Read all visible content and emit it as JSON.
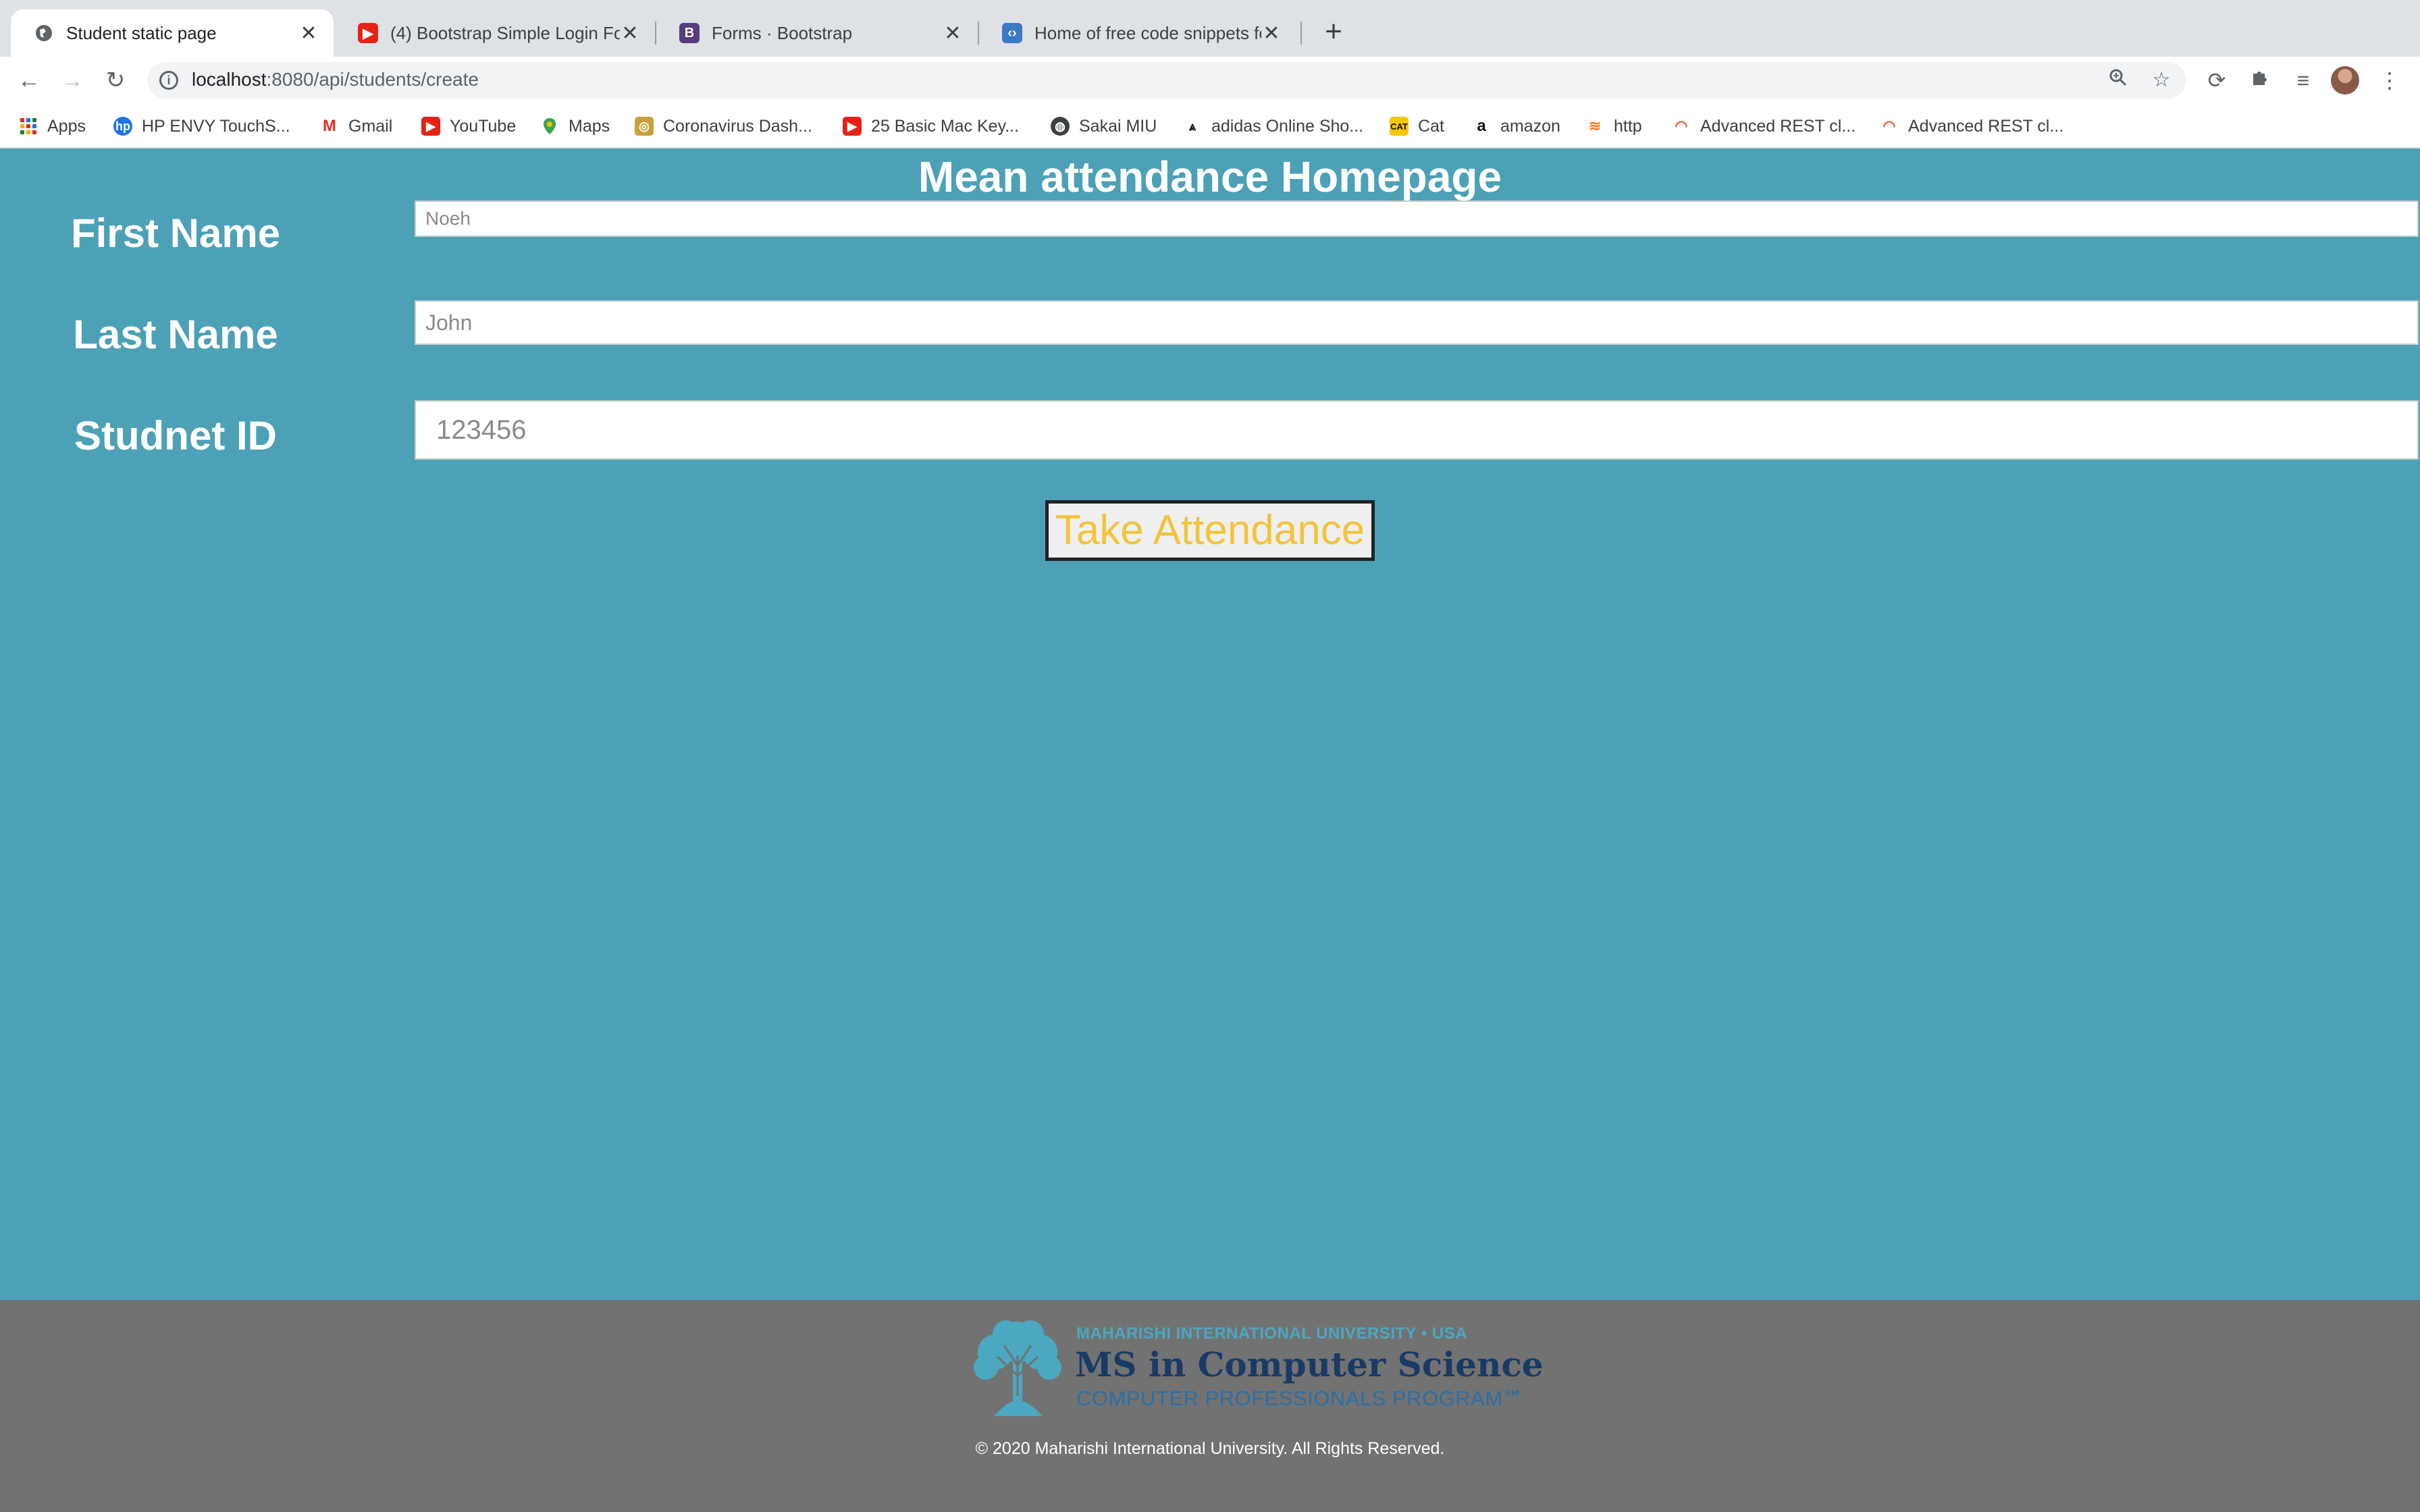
{
  "browser": {
    "tabs": [
      {
        "title": "Student static page",
        "active": true,
        "icon": "globe-icon"
      },
      {
        "title": "(4) Bootstrap Simple Login Form",
        "active": false,
        "icon": "youtube-icon"
      },
      {
        "title": "Forms · Bootstrap",
        "active": false,
        "icon": "bootstrap-icon"
      },
      {
        "title": "Home of free code snippets for",
        "active": false,
        "icon": "snippets-icon"
      }
    ],
    "url_host": "localhost",
    "url_path": ":8080/api/students/create",
    "bookmarks": [
      {
        "label": "Apps",
        "icon": "apps-grid-icon"
      },
      {
        "label": "HP ENVY TouchS...",
        "icon": "hp-icon"
      },
      {
        "label": "Gmail",
        "icon": "gmail-icon"
      },
      {
        "label": "YouTube",
        "icon": "youtube-icon"
      },
      {
        "label": "Maps",
        "icon": "maps-icon"
      },
      {
        "label": "Coronavirus Dash...",
        "icon": "dashboard-icon"
      },
      {
        "label": "25 Basic Mac Key...",
        "icon": "youtube-icon"
      },
      {
        "label": "Sakai MIU",
        "icon": "globe-icon"
      },
      {
        "label": "adidas Online Sho...",
        "icon": "adidas-icon"
      },
      {
        "label": "Cat",
        "icon": "cat-icon"
      },
      {
        "label": "amazon",
        "icon": "amazon-icon"
      },
      {
        "label": "http",
        "icon": "stackoverflow-icon"
      },
      {
        "label": "Advanced REST cl...",
        "icon": "rest-client-icon"
      },
      {
        "label": "Advanced REST cl...",
        "icon": "rest-client-icon"
      }
    ]
  },
  "page": {
    "title": "Mean attendance Homepage",
    "form": {
      "first_name_label": "First Name",
      "first_name_placeholder": "Noeh",
      "last_name_label": "Last Name",
      "last_name_placeholder": "John",
      "student_id_label": "Studnet ID",
      "student_id_placeholder": "123456",
      "submit_label": "Take Attendance"
    }
  },
  "footer": {
    "university": "MAHARISHI INTERNATIONAL UNIVERSITY • USA",
    "program": "MS in Computer Science",
    "subtitle": "COMPUTER PROFESSIONALS PROGRAM℠",
    "copyright": "© 2020 Maharishi International University. All Rights Reserved."
  },
  "colors": {
    "page_background": "#4ca1b6",
    "footer_background": "#727272",
    "button_text": "#f3c33b"
  }
}
